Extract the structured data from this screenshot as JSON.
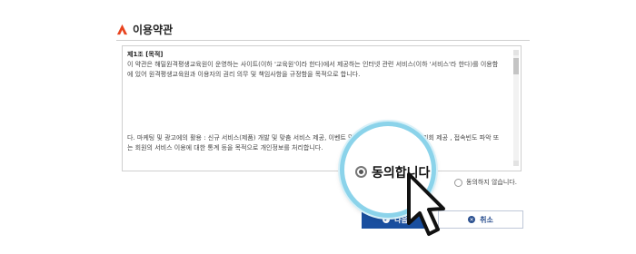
{
  "header": {
    "title": "이용약관",
    "logo_icon": "brand-a-logo",
    "accent_color": "#e8441f"
  },
  "terms": {
    "heading": "제1조 [목적]",
    "line1": "이 약관은 해밀원격평생교육원이 운영하는 사이트(이하 '교육원'이라 한다)에서 제공하는 인터넷 관련 서비스(이하 '서비스'라 한다)를 이용함",
    "line2": "에 있어 원격평생교육원과 이용자의 권리 의무 및 책임사항을 규정함을 목적으로 합니다.",
    "lower_line1": "다. 마케팅 및 광고에의 활용 : 신규 서비스(제품) 개발 및 맞춤 서비스 제공, 이벤트 및 광고성 정보 제공 및 참여기회 제공 , 접속빈도 파악 또",
    "lower_line2": "는 회원의 서비스 이용에 대한 통계 등을 목적으로 개인정보를 처리합니다."
  },
  "options": {
    "agree_label": "동의합니다.",
    "disagree_label": "동의하지 않습니다."
  },
  "buttons": {
    "agree_label": "다음",
    "cancel_label": "취소"
  },
  "colors": {
    "primary_button": "#1a4f9f",
    "magnifier_ring": "#8bd3ea"
  }
}
